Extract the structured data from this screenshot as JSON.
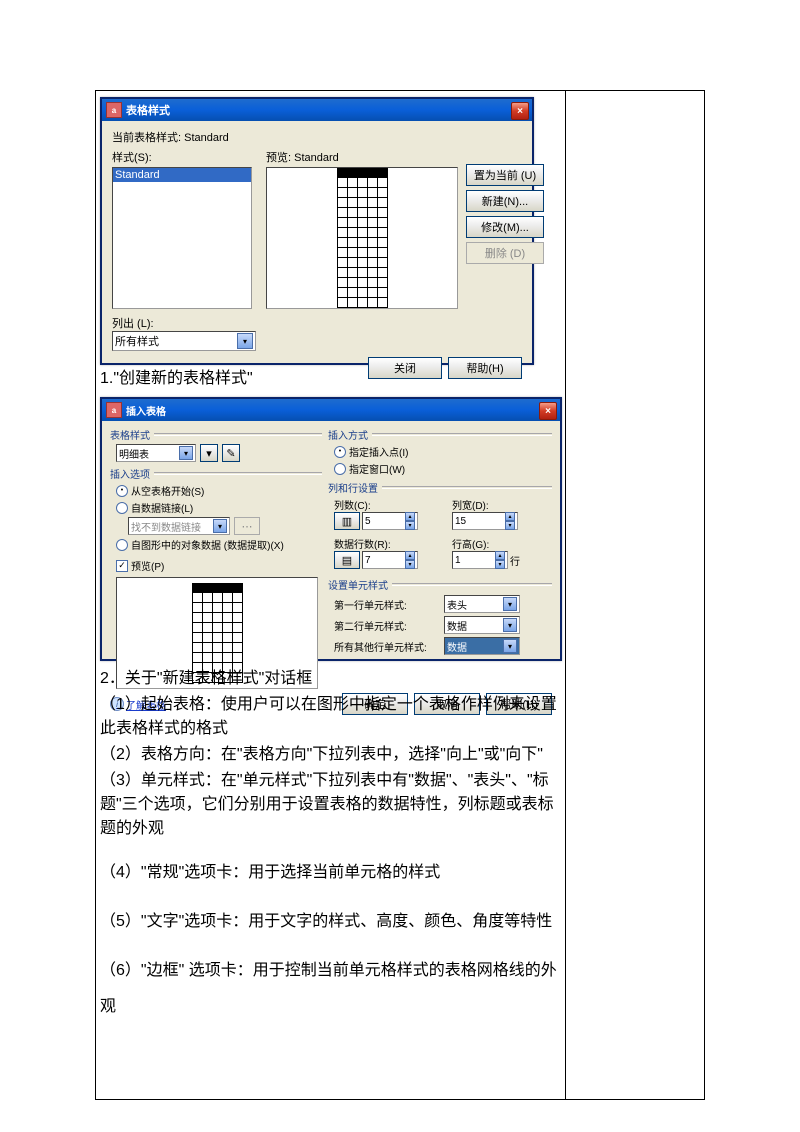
{
  "dialog1": {
    "title": "表格样式",
    "current_style_label": "当前表格样式: Standard",
    "style_list_label": "样式(S):",
    "style_selected": "Standard",
    "preview_label": "预览: Standard",
    "list_label": "列出 (L):",
    "list_value": "所有样式",
    "btn_set_current": "置为当前 (U)",
    "btn_new": "新建(N)...",
    "btn_modify": "修改(M)...",
    "btn_delete": "删除 (D)",
    "btn_close": "关闭",
    "btn_help": "帮助(H)"
  },
  "caption1": "1.\"创建新的表格样式\"",
  "dialog2": {
    "title": "插入表格",
    "group_style": "表格样式",
    "style_value": "明细表",
    "group_insert_opt": "插入选项",
    "opt_blank": "从空表格开始(S)",
    "opt_link": "自数据链接(L)",
    "opt_link_sub": "找不到数据链接",
    "opt_extract": "自图形中的对象数据 (数据提取)(X)",
    "chk_preview": "预览(P)",
    "group_insert_method": "插入方式",
    "method_point": "指定插入点(I)",
    "method_window": "指定窗口(W)",
    "group_rowcol": "列和行设置",
    "cols_label": "列数(C):",
    "cols_val": "5",
    "colwidth_label": "列宽(D):",
    "colwidth_val": "15",
    "rows_label": "数据行数(R):",
    "rows_val": "7",
    "rowheight_label": "行高(G):",
    "rowheight_val": "1",
    "rowheight_unit": "行",
    "group_cellstyle": "设置单元样式",
    "row1_style_label": "第一行单元样式:",
    "row1_style_val": "表头",
    "row2_style_label": "第二行单元样式:",
    "row2_style_val": "数据",
    "other_style_label": "所有其他行单元样式:",
    "other_style_val": "数据",
    "link_more": "了解表格",
    "btn_ok": "确定",
    "btn_cancel": "取消",
    "btn_help": "帮助(H)"
  },
  "caption2": "2．关于\"新建表格样式\"对话框",
  "body": {
    "p1": "（1）起始表格：使用户可以在图形中指定一个表格作样例来设置此表格样式的格式",
    "p2": "（2）表格方向：在\"表格方向\"下拉列表中，选择\"向上\"或\"向下\"",
    "p3": "（3）单元样式：在\"单元样式\"下拉列表中有\"数据\"、\"表头\"、\"标题\"三个选项，它们分别用于设置表格的数据特性，列标题或表标题的外观",
    "p4": "（4）\"常规\"选项卡：用于选择当前单元格的样式",
    "p5": "（5）\"文字\"选项卡：用于文字的样式、高度、颜色、角度等特性",
    "p6": "（6）\"边框\" 选项卡：用于控制当前单元格样式的表格网格线的外观"
  }
}
